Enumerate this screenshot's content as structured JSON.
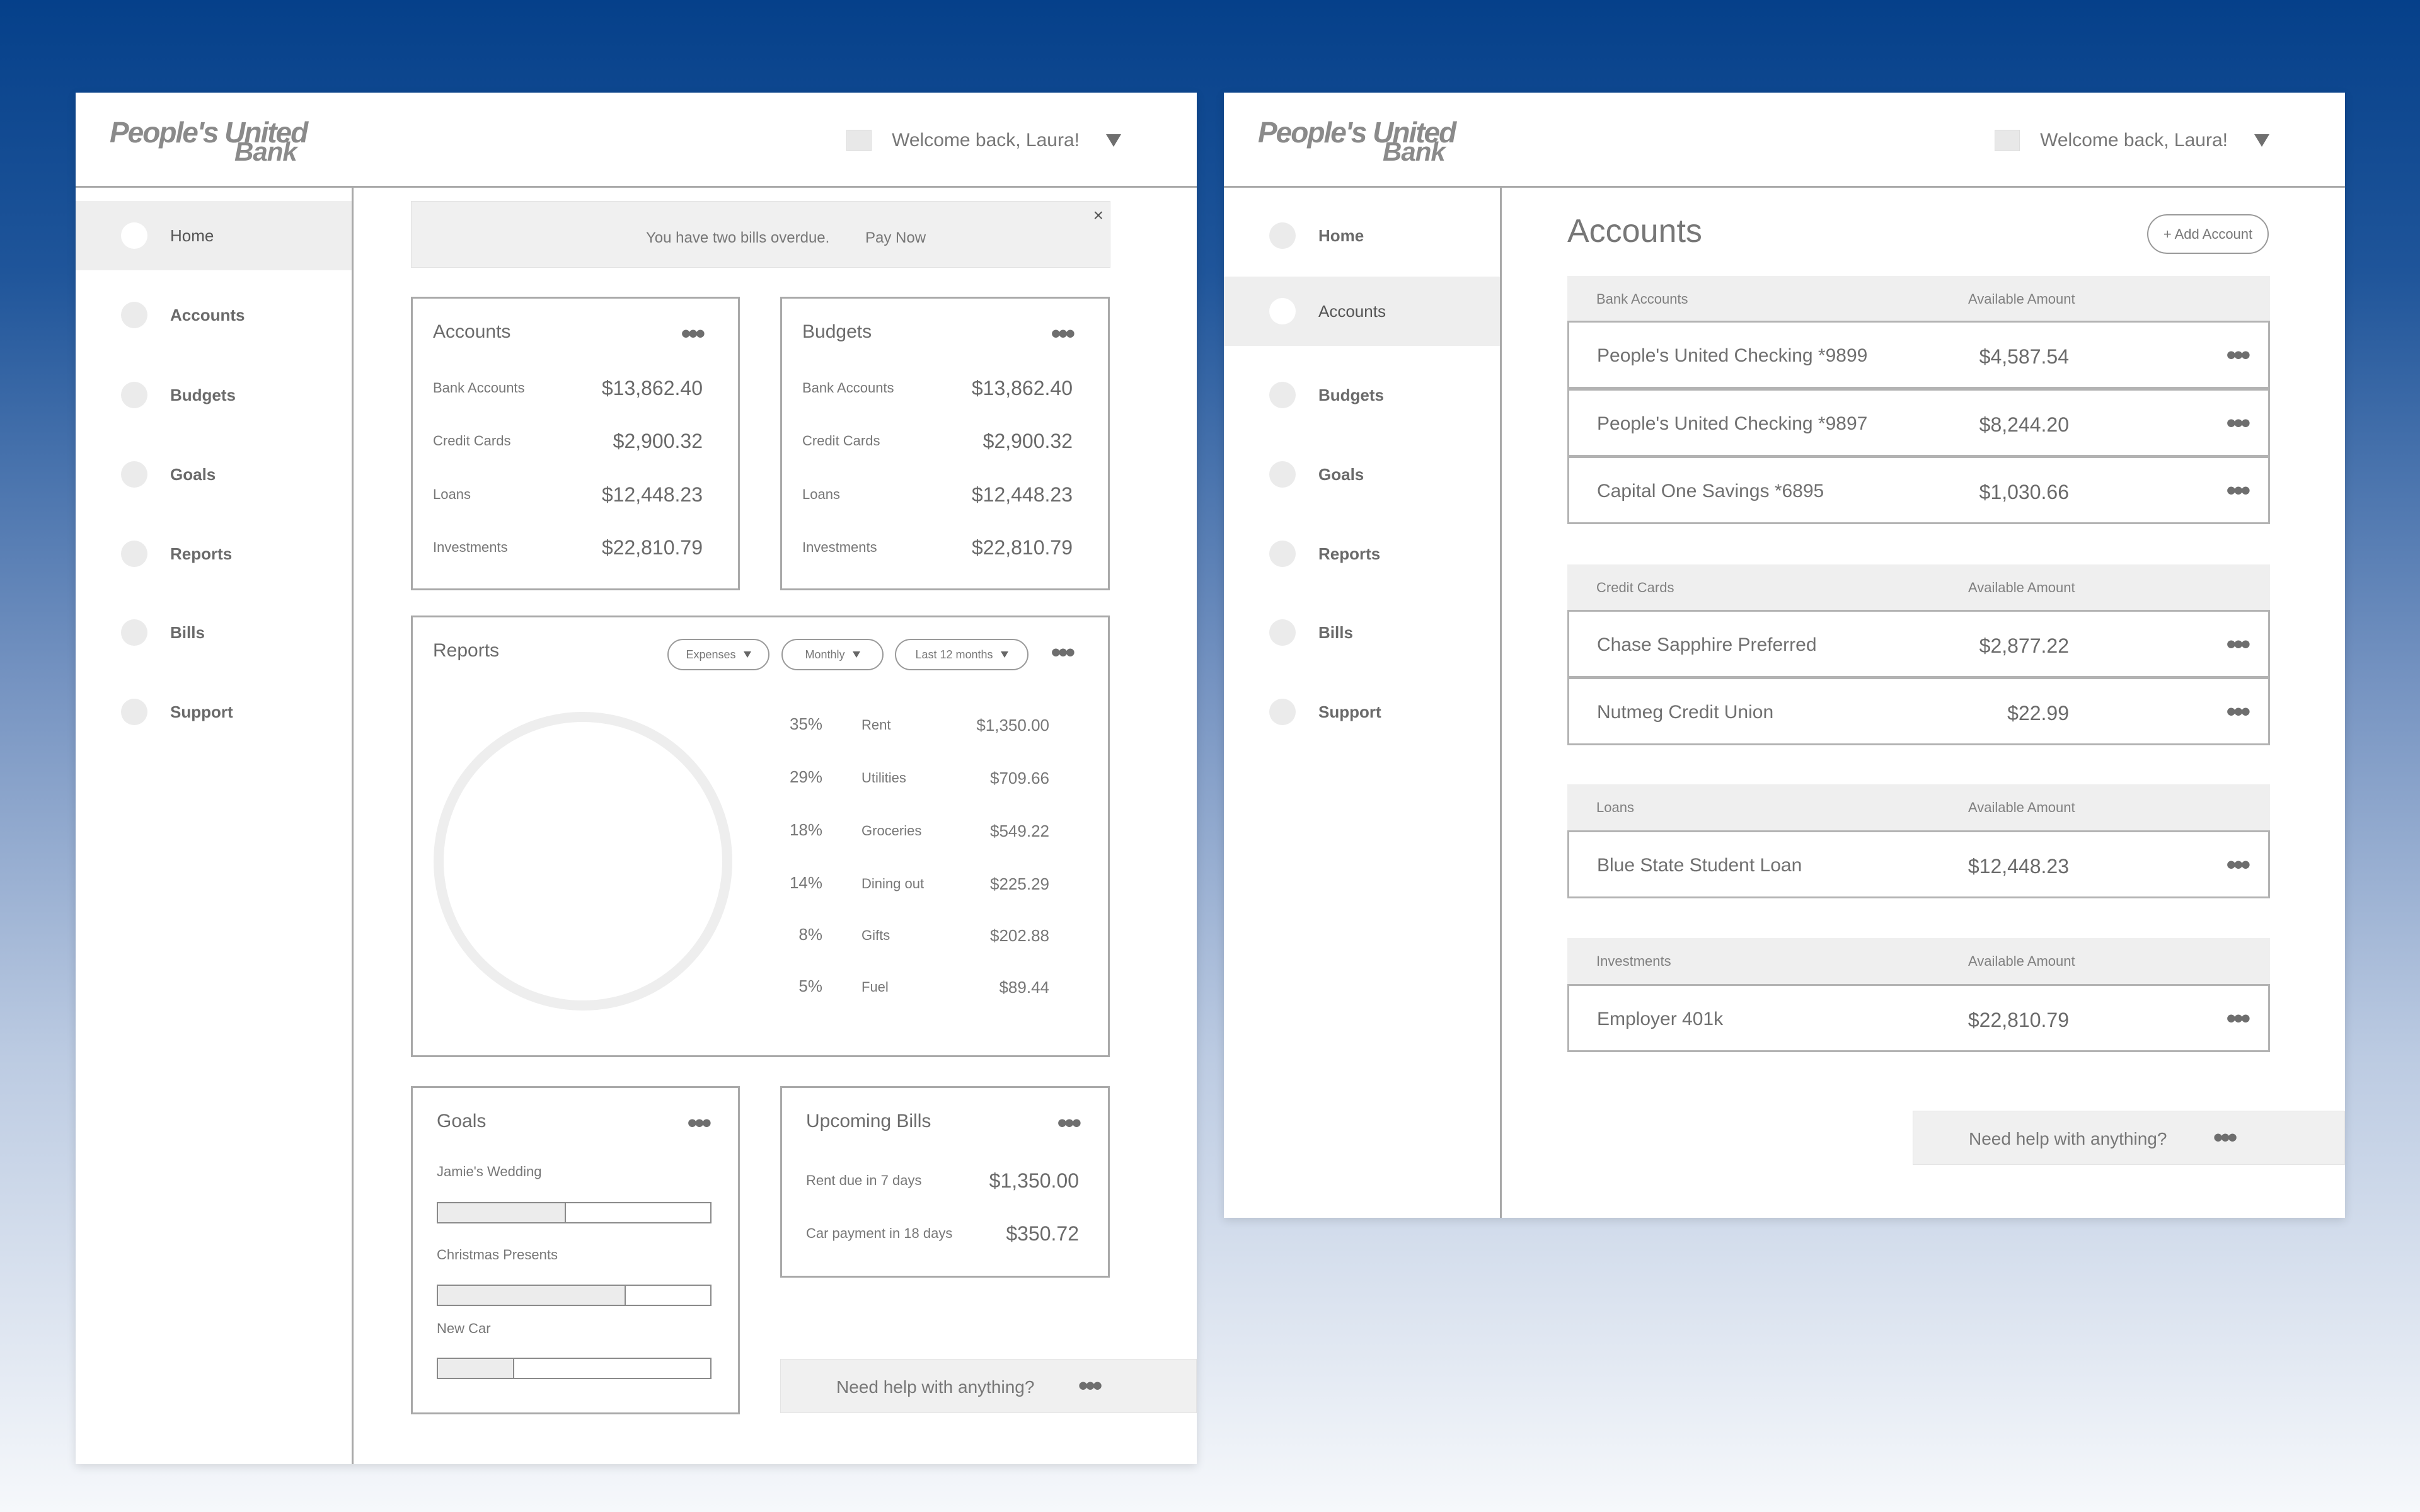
{
  "colors": {
    "background_top": "#05408a",
    "background_bottom": "#f6f8fb",
    "border": "#a9a9a9",
    "panel": "#efefef"
  },
  "brand": {
    "logo_line1": "People's United",
    "logo_line2": "Bank"
  },
  "user": {
    "welcome": "Welcome back, Laura!"
  },
  "nav": {
    "items": [
      {
        "label": "Home",
        "icon": "circle-icon"
      },
      {
        "label": "Accounts",
        "icon": "circle-icon"
      },
      {
        "label": "Budgets",
        "icon": "circle-icon"
      },
      {
        "label": "Goals",
        "icon": "circle-icon"
      },
      {
        "label": "Reports",
        "icon": "circle-icon"
      },
      {
        "label": "Bills",
        "icon": "circle-icon"
      },
      {
        "label": "Support",
        "icon": "circle-icon"
      }
    ]
  },
  "home": {
    "active_nav": "Home",
    "banner": {
      "message": "You have two bills overdue.",
      "action": "Pay Now",
      "close": "×"
    },
    "accounts_card": {
      "title": "Accounts",
      "rows": [
        {
          "label": "Bank Accounts",
          "value": "$13,862.40"
        },
        {
          "label": "Credit Cards",
          "value": "$2,900.32"
        },
        {
          "label": "Loans",
          "value": "$12,448.23"
        },
        {
          "label": "Investments",
          "value": "$22,810.79"
        }
      ]
    },
    "budgets_card": {
      "title": "Budgets",
      "rows": [
        {
          "label": "Bank Accounts",
          "value": "$13,862.40"
        },
        {
          "label": "Credit Cards",
          "value": "$2,900.32"
        },
        {
          "label": "Loans",
          "value": "$12,448.23"
        },
        {
          "label": "Investments",
          "value": "$22,810.79"
        }
      ]
    },
    "reports_card": {
      "title": "Reports",
      "filters": [
        "Expenses",
        "Monthly",
        "Last 12 months"
      ],
      "legend": [
        {
          "pct": "35%",
          "name": "Rent",
          "amount": "$1,350.00"
        },
        {
          "pct": "29%",
          "name": "Utilities",
          "amount": "$709.66"
        },
        {
          "pct": "18%",
          "name": "Groceries",
          "amount": "$549.22"
        },
        {
          "pct": "14%",
          "name": "Dining out",
          "amount": "$225.29"
        },
        {
          "pct": "8%",
          "name": "Gifts",
          "amount": "$202.88"
        },
        {
          "pct": "5%",
          "name": "Fuel",
          "amount": "$89.44"
        }
      ]
    },
    "goals_card": {
      "title": "Goals",
      "goals": [
        {
          "label": "Jamie's Wedding",
          "progress": 0.47
        },
        {
          "label": "Christmas Presents",
          "progress": 0.69
        },
        {
          "label": "New Car",
          "progress": 0.28
        }
      ]
    },
    "bills_card": {
      "title": "Upcoming Bills",
      "rows": [
        {
          "label": "Rent due in 7 days",
          "value": "$1,350.00"
        },
        {
          "label": "Car payment in 18 days",
          "value": "$350.72"
        }
      ]
    },
    "help": "Need help with anything?"
  },
  "accounts_page": {
    "active_nav": "Accounts",
    "title": "Accounts",
    "add_button": "+ Add Account",
    "amount_header": "Available Amount",
    "sections": [
      {
        "name": "Bank Accounts",
        "rows": [
          {
            "name": "People's United Checking *9899",
            "amount": "$4,587.54"
          },
          {
            "name": "People's United Checking *9897",
            "amount": "$8,244.20"
          },
          {
            "name": "Capital One Savings *6895",
            "amount": "$1,030.66"
          }
        ]
      },
      {
        "name": "Credit Cards",
        "rows": [
          {
            "name": "Chase Sapphire Preferred",
            "amount": "$2,877.22"
          },
          {
            "name": "Nutmeg Credit Union",
            "amount": "$22.99"
          }
        ]
      },
      {
        "name": "Loans",
        "rows": [
          {
            "name": "Blue State Student Loan",
            "amount": "$12,448.23"
          }
        ]
      },
      {
        "name": "Investments",
        "rows": [
          {
            "name": "Employer 401k",
            "amount": "$22,810.79"
          }
        ]
      }
    ],
    "help": "Need help with anything?"
  }
}
